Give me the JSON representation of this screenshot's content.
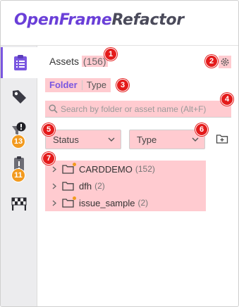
{
  "app": {
    "brand_part1": "OpenFrame",
    "brand_part2": "Refactor"
  },
  "sidebar": {
    "items": [
      {
        "name": "clipboard-list",
        "active": true,
        "badge": ""
      },
      {
        "name": "tag",
        "active": false,
        "badge": ""
      },
      {
        "name": "alert-funnel",
        "active": false,
        "badge": "13"
      },
      {
        "name": "clipboard-warning",
        "active": false,
        "badge": "11"
      },
      {
        "name": "checkered-flag",
        "active": false,
        "badge": ""
      }
    ]
  },
  "assets": {
    "title": "Assets",
    "count": "(156)",
    "toggles": {
      "folder": "Folder",
      "type": "Type"
    },
    "search_placeholder": "Search by folder or asset name (Alt+F)",
    "status_label": "Status",
    "type_label": "Type",
    "tree": [
      {
        "name": "CARDDEMO",
        "count": "(152)",
        "marked": true
      },
      {
        "name": "dfh",
        "count": "(2)",
        "marked": false
      },
      {
        "name": "issue_sample",
        "count": "(2)",
        "marked": true
      }
    ]
  },
  "markers": [
    "1",
    "2",
    "3",
    "4",
    "5",
    "6",
    "7"
  ],
  "colors": {
    "brand_accent": "#6a3fd8",
    "brand_secondary": "#4a4a5a",
    "badge": "#f29a1f",
    "marker": "#e41b1b",
    "highlight": "#ffa0aa"
  }
}
